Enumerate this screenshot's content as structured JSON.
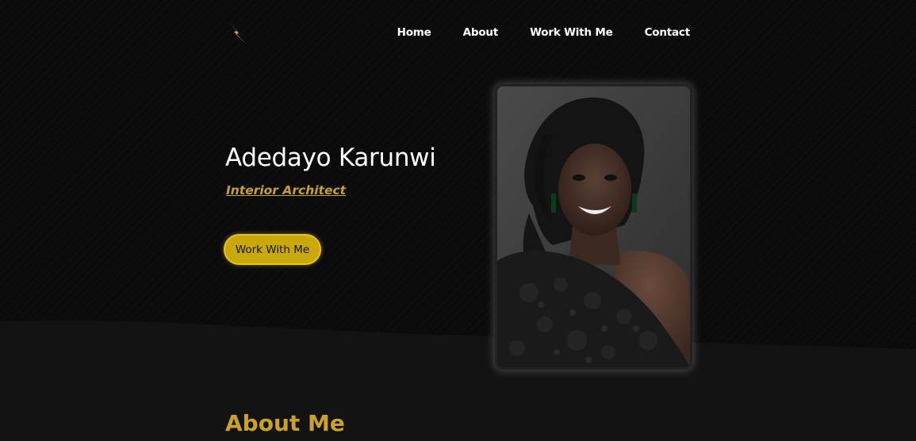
{
  "header": {
    "logo_icon": "lightning-bolt-icon",
    "nav": [
      {
        "label": "Home"
      },
      {
        "label": "About"
      },
      {
        "label": "Work With Me"
      },
      {
        "label": "Contact"
      }
    ]
  },
  "hero": {
    "name": "Adedayo Karunwi",
    "role": "Interior Architect",
    "cta_label": "Work With Me",
    "photo_icon": "portrait-photo"
  },
  "about": {
    "title": "About Me"
  },
  "colors": {
    "background": "#0b0b0b",
    "accent": "#c9a227",
    "button": "#c8a80a",
    "text": "#ffffff"
  }
}
